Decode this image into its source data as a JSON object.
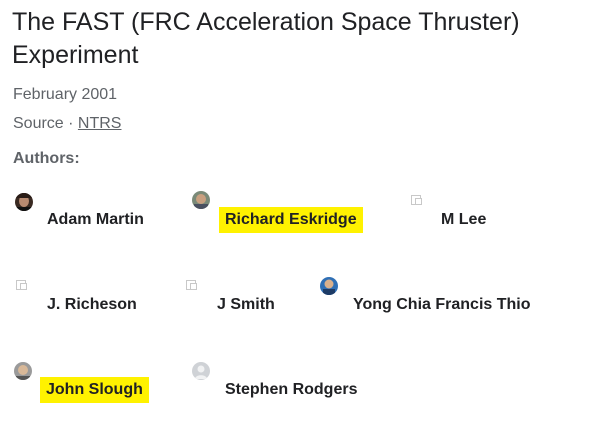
{
  "title": "The FAST (FRC Acceleration Space Thruster) Experiment",
  "date": "February 2001",
  "source": {
    "prefix": "Source · ",
    "link_text": "NTRS"
  },
  "authors_heading": "Authors:",
  "authors": [
    {
      "name": "Adam Martin",
      "avatar": "photo",
      "highlight": false
    },
    {
      "name": "Richard Eskridge",
      "avatar": "photo",
      "highlight": true
    },
    {
      "name": "M Lee",
      "avatar": "broken-image-icon",
      "highlight": false
    },
    {
      "name": "J. Richeson",
      "avatar": "broken-image-icon",
      "highlight": false
    },
    {
      "name": "J Smith",
      "avatar": "broken-image-icon",
      "highlight": false
    },
    {
      "name": "Yong Chia Francis Thio",
      "avatar": "photo",
      "highlight": false
    },
    {
      "name": "John Slough",
      "avatar": "photo",
      "highlight": true
    },
    {
      "name": "Stephen Rodgers",
      "avatar": "default-person-icon",
      "highlight": false
    }
  ],
  "colors": {
    "highlight": "#fff200",
    "text": "#202124",
    "muted": "#5f6368"
  }
}
